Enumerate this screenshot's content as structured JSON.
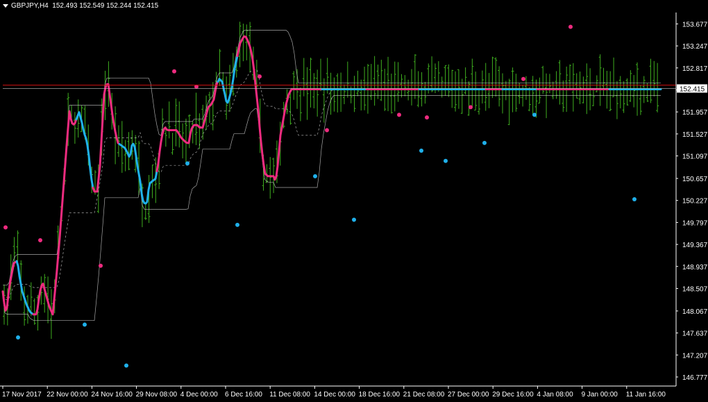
{
  "header": {
    "symbol": "GBPJPY,H4",
    "ohlc": "152.493 152.549 152.244 152.415"
  },
  "colors": {
    "background": "#000000",
    "bars": "#3fae1f",
    "uptrend": "#1fb0ea",
    "downtrend": "#ee2b7f",
    "envelope": "#d0d0d0",
    "price_line": "#c0c0c0",
    "horizontal_line": "#d01010",
    "axis_text": "#ffffff"
  },
  "chart_data": {
    "type": "line",
    "subtype": "ohlc-bars-with-trend-indicator",
    "symbol": "GBPJPY",
    "timeframe": "H4",
    "current_price": "152.415",
    "horizontal_line": 152.48,
    "ylim": [
      146.6,
      153.9
    ],
    "y_ticks": [
      "153.677",
      "153.247",
      "152.817",
      "152.387",
      "151.957",
      "151.527",
      "151.097",
      "150.657",
      "150.227",
      "149.797",
      "149.367",
      "148.937",
      "148.507",
      "148.067",
      "147.637",
      "147.207",
      "146.777"
    ],
    "x_ticks": [
      "17 Nov 2017",
      "22 Nov 00:00",
      "24 Nov 16:00",
      "29 Nov 08:00",
      "4 Dec 00:00",
      "6 Dec 16:00",
      "11 Dec 08:00",
      "14 Dec 00:00",
      "18 Dec 16:00",
      "21 Dec 08:00",
      "27 Dec 00:00",
      "29 Dec 16:00",
      "4 Jan 08:00",
      "9 Jan 00:00",
      "11 Jan 16:00"
    ],
    "bar_count": 195,
    "trend_line": [
      [
        0,
        149.0
      ],
      [
        2,
        148.75
      ],
      [
        5,
        148.3
      ],
      [
        9,
        148.0
      ],
      [
        13,
        148.5
      ],
      [
        17,
        148.8
      ],
      [
        20,
        149.0
      ],
      [
        25,
        149.05
      ],
      [
        28,
        148.75
      ],
      [
        32,
        148.45
      ],
      [
        38,
        148.2
      ],
      [
        43,
        148.05
      ],
      [
        48,
        148.0
      ],
      [
        53,
        148.0
      ],
      [
        56,
        148.3
      ],
      [
        59,
        148.55
      ],
      [
        62,
        148.6
      ],
      [
        67,
        148.35
      ],
      [
        71,
        148.15
      ],
      [
        76,
        148.0
      ],
      [
        81,
        148.7
      ],
      [
        86,
        149.5
      ],
      [
        91,
        150.4
      ],
      [
        96,
        151.3
      ],
      [
        100,
        151.97
      ],
      [
        103,
        151.75
      ],
      [
        107,
        151.7
      ],
      [
        111,
        151.85
      ],
      [
        114,
        151.95
      ],
      [
        118,
        151.75
      ],
      [
        121,
        151.55
      ],
      [
        125,
        151.4
      ],
      [
        128,
        151.1
      ],
      [
        131,
        150.7
      ],
      [
        135,
        150.4
      ],
      [
        140,
        150.4
      ],
      [
        144,
        150.9
      ],
      [
        147,
        151.6
      ],
      [
        150,
        152.3
      ],
      [
        153,
        152.5
      ],
      [
        156,
        152.5
      ],
      [
        160,
        152.1
      ],
      [
        163,
        151.8
      ],
      [
        167,
        151.5
      ],
      [
        170,
        151.35
      ],
      [
        175,
        151.3
      ],
      [
        180,
        151.25
      ],
      [
        184,
        151.15
      ],
      [
        187,
        151.05
      ],
      [
        190,
        151.3
      ],
      [
        193,
        151.35
      ],
      [
        195,
        151.2
      ],
      [
        198,
        150.9
      ],
      [
        202,
        150.6
      ],
      [
        205,
        150.25
      ],
      [
        209,
        150.15
      ],
      [
        212,
        150.2
      ],
      [
        215,
        150.55
      ],
      [
        219,
        150.6
      ],
      [
        224,
        150.65
      ],
      [
        228,
        150.95
      ],
      [
        231,
        151.3
      ],
      [
        235,
        151.6
      ],
      [
        238,
        151.65
      ],
      [
        241,
        151.6
      ],
      [
        246,
        151.6
      ],
      [
        250,
        151.6
      ],
      [
        254,
        151.6
      ],
      [
        257,
        151.55
      ],
      [
        261,
        151.45
      ],
      [
        265,
        151.4
      ],
      [
        269,
        151.35
      ],
      [
        272,
        151.35
      ],
      [
        275,
        151.6
      ],
      [
        279,
        151.7
      ],
      [
        284,
        151.7
      ],
      [
        288,
        151.65
      ],
      [
        292,
        151.65
      ],
      [
        296,
        151.85
      ],
      [
        300,
        152.05
      ],
      [
        304,
        152.1
      ],
      [
        308,
        152.2
      ],
      [
        312,
        152.5
      ],
      [
        316,
        152.6
      ],
      [
        320,
        152.55
      ],
      [
        324,
        152.3
      ],
      [
        327,
        152.1
      ],
      [
        331,
        152.25
      ],
      [
        335,
        152.5
      ],
      [
        338,
        152.8
      ],
      [
        342,
        153.05
      ],
      [
        346,
        153.3
      ],
      [
        350,
        153.4
      ],
      [
        353,
        153.45
      ],
      [
        357,
        153.35
      ],
      [
        361,
        153.2
      ],
      [
        365,
        152.9
      ],
      [
        368,
        152.5
      ],
      [
        372,
        152.0
      ],
      [
        375,
        151.5
      ],
      [
        379,
        151.0
      ],
      [
        382,
        150.75
      ],
      [
        386,
        150.7
      ],
      [
        391,
        150.7
      ],
      [
        394,
        150.7
      ],
      [
        397,
        150.6
      ],
      [
        400,
        150.9
      ],
      [
        404,
        151.5
      ],
      [
        408,
        151.8
      ],
      [
        412,
        152.1
      ],
      [
        416,
        152.3
      ],
      [
        420,
        152.4
      ]
    ],
    "trend_down_ranges": [
      [
        0,
        9
      ],
      [
        20,
        48
      ],
      [
        59,
        76
      ],
      [
        100,
        140
      ],
      [
        153,
        209
      ],
      [
        238,
        272
      ],
      [
        316,
        327
      ],
      [
        350,
        397
      ]
    ],
    "dots_down": [
      [
        8,
        149.7
      ],
      [
        58,
        149.45
      ],
      [
        145,
        148.95
      ],
      [
        251,
        152.75
      ],
      [
        283,
        152.45
      ],
      [
        374,
        152.65
      ],
      [
        471,
        151.6
      ],
      [
        575,
        151.9
      ],
      [
        615,
        151.85
      ],
      [
        678,
        152.05
      ],
      [
        754,
        152.6
      ],
      [
        822,
        153.62
      ]
    ],
    "dots_up": [
      [
        26,
        147.55
      ],
      [
        122,
        147.8
      ],
      [
        182,
        147.0
      ],
      [
        270,
        150.95
      ],
      [
        342,
        149.75
      ],
      [
        454,
        150.7
      ],
      [
        510,
        149.85
      ],
      [
        607,
        151.2
      ],
      [
        642,
        151.0
      ],
      [
        698,
        151.35
      ],
      [
        770,
        151.9
      ],
      [
        914,
        150.25
      ]
    ]
  }
}
